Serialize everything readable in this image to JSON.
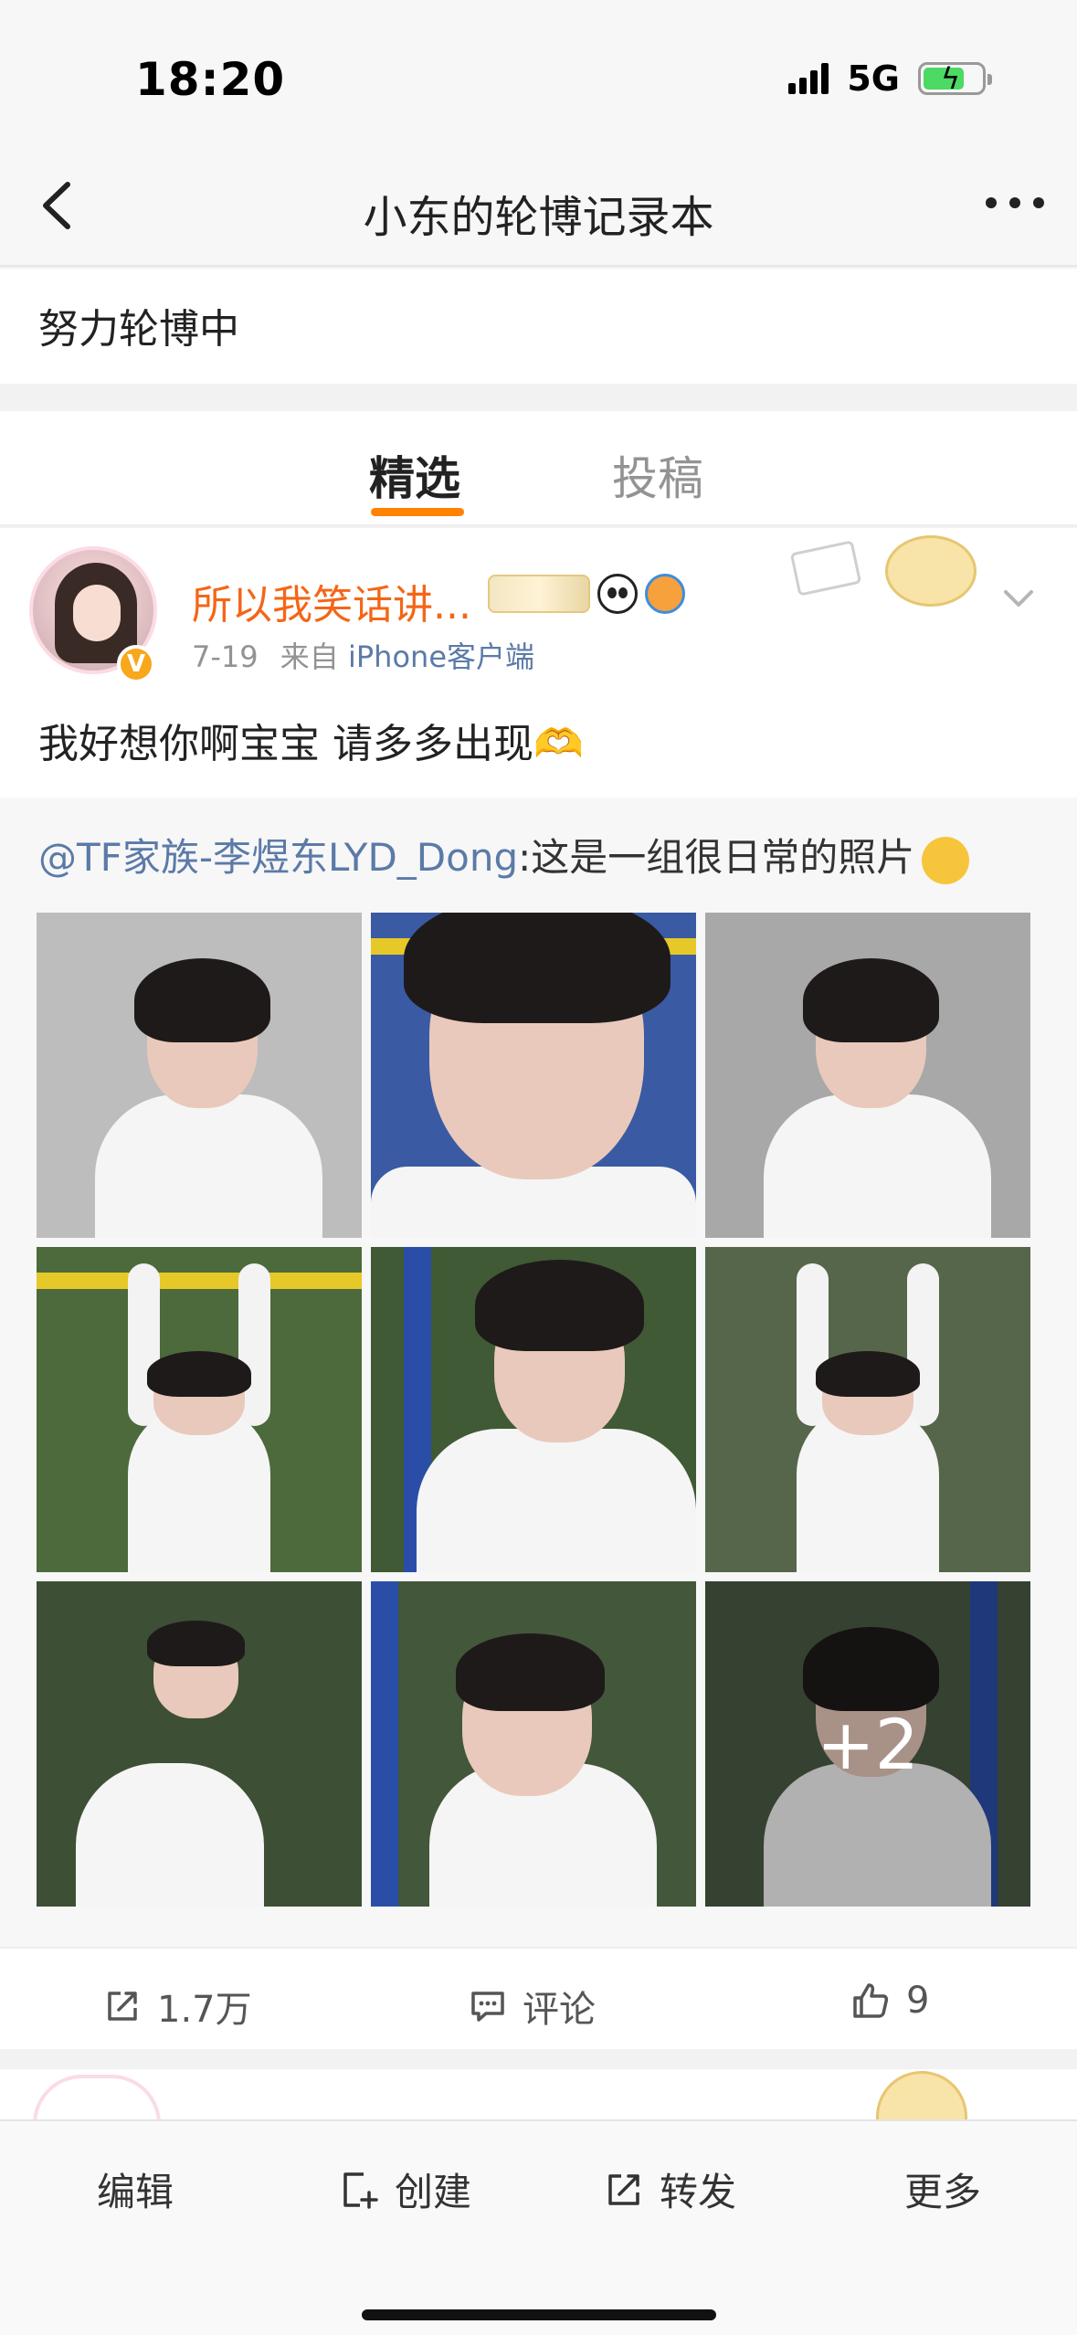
{
  "status_bar": {
    "time": "18:20",
    "network": "5G"
  },
  "nav": {
    "title": "小东的轮博记录本"
  },
  "description": "努力轮博中",
  "tabs": [
    {
      "label": "精选",
      "active": true
    },
    {
      "label": "投稿",
      "active": false
    }
  ],
  "post": {
    "user_name": "所以我笑话讲...",
    "date": "7-19",
    "from_prefix": "来自",
    "source": "iPhone客户端",
    "text": "我好想你啊宝宝 请多多出现",
    "text_emoji": "🫶"
  },
  "repost": {
    "mention": "@TF家族-李煜东LYD_Dong",
    "text": ":这是一组很日常的照片",
    "more_count": "+2"
  },
  "actions": {
    "share_count": "1.7万",
    "comment_label": "评论",
    "like_count": "9"
  },
  "toolbar": {
    "edit": "编辑",
    "create": "创建",
    "forward": "转发",
    "more": "更多"
  },
  "colors": {
    "accent_orange": "#ff8200",
    "username_orange": "#f46617",
    "link_blue": "#5b7aa8"
  }
}
